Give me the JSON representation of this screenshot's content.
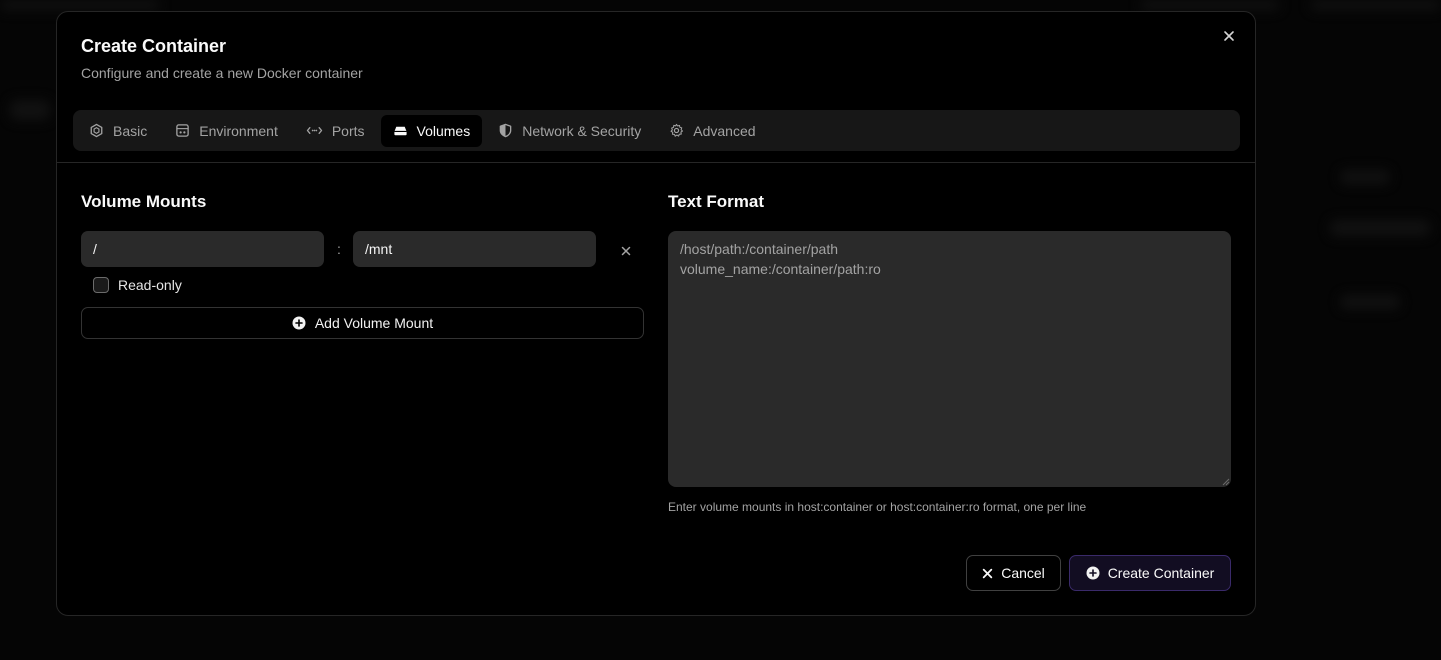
{
  "dialog": {
    "title": "Create Container",
    "subtitle": "Configure and create a new Docker container"
  },
  "tabs": [
    {
      "label": "Basic",
      "icon": "hexagon-icon",
      "active": false
    },
    {
      "label": "Environment",
      "icon": "env-icon",
      "active": false
    },
    {
      "label": "Ports",
      "icon": "arrows-horizontal-icon",
      "active": false
    },
    {
      "label": "Volumes",
      "icon": "hard-drive-icon",
      "active": true
    },
    {
      "label": "Network & Security",
      "icon": "shield-icon",
      "active": false
    },
    {
      "label": "Advanced",
      "icon": "gear-icon",
      "active": false
    }
  ],
  "volumes": {
    "title": "Volume Mounts",
    "mount": {
      "host_path": "/",
      "separator": ":",
      "container_path": "/mnt",
      "readonly_label": "Read-only",
      "readonly_checked": false
    },
    "add_label": "Add Volume Mount"
  },
  "text_format": {
    "title": "Text Format",
    "placeholder": "/host/path:/container/path\nvolume_name:/container/path:ro",
    "helper": "Enter volume mounts in host:container or host:container:ro format, one per line"
  },
  "footer": {
    "cancel_label": "Cancel",
    "create_label": "Create Container"
  },
  "colors": {
    "background": "#000000",
    "input_bg": "#2a2a2a",
    "tab_bar": "#171717",
    "accent_border": "#3a2a6a"
  }
}
